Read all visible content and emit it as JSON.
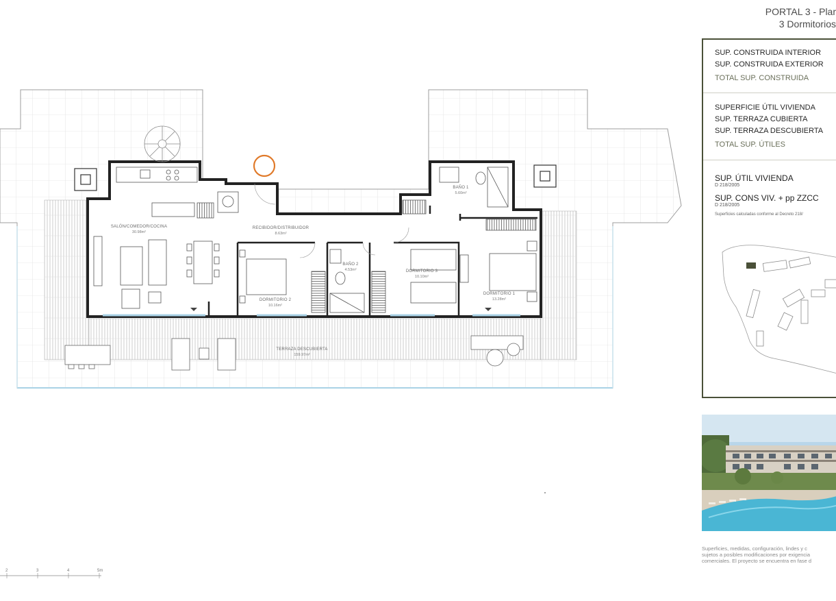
{
  "header": {
    "line1": "PORTAL 3 - Plar",
    "line2": "3 Dormitorios"
  },
  "areas": {
    "constructed": [
      "SUP. CONSTRUIDA INTERIOR",
      "SUP. CONSTRUIDA EXTERIOR"
    ],
    "constructed_total": "TOTAL SUP. CONSTRUIDA",
    "useful": [
      "SUPERFICIE ÚTIL VIVIENDA",
      "SUP. TERRAZA CUBIERTA",
      "SUP. TERRAZA DESCUBIERTA"
    ],
    "useful_total": "TOTAL SUP. ÚTILES",
    "sup_util": "SUP. ÚTIL VIVIENDA",
    "sup_util_ref": "D 218/2005",
    "sup_cons": "SUP. CONS VIV. + pp ZZCC",
    "sup_cons_ref": "D 218/2005",
    "note": "Superficies calculadas conforme al Decreto 218/"
  },
  "rooms": [
    {
      "name": "SALÓN/COMEDOR/COCINA",
      "area": "30.98m²"
    },
    {
      "name": "RECIBIDOR/DISTRIBUIDOR",
      "area": "8.63m²"
    },
    {
      "name": "BAÑO 1",
      "area": "5.60m²"
    },
    {
      "name": "BAÑO 2",
      "area": "4.53m²"
    },
    {
      "name": "DORMITORIO 2",
      "area": "10.16m²"
    },
    {
      "name": "DORMITORIO 3",
      "area": "10.10m²"
    },
    {
      "name": "DORMITORIO 1",
      "area": "13.28m²"
    },
    {
      "name": "TERRAZA DESCUBIERTA",
      "area": "159.97m²"
    }
  ],
  "scale": {
    "ticks": [
      "2",
      "3",
      "4",
      "5m"
    ]
  },
  "disclaimer": [
    "Superficies, medidas, configuración, lindes y c",
    "sujetos a posibles modificaciones por exigencia",
    "comerciales. El proyecto se encuentra en fase d"
  ],
  "colors": {
    "frame": "#4a5038",
    "accent": "#e07a2a",
    "glass": "#a9d2e6",
    "wall": "#222222"
  },
  "icons": {
    "location": "north-marker-icon",
    "stairs": "spiral-stair-icon"
  }
}
